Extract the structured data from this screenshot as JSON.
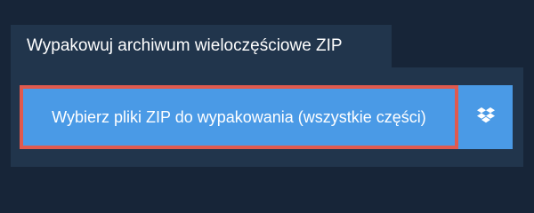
{
  "header": {
    "title": "Wypakowuj archiwum wieloczęściowe ZIP"
  },
  "upload": {
    "select_button_label": "Wybierz pliki ZIP do wypakowania (wszystkie części)",
    "dropbox_icon": "dropbox-icon"
  },
  "colors": {
    "page_background": "#172538",
    "panel_background": "#21354c",
    "button_background": "#4a9ae6",
    "button_focus_border": "#e05a4e",
    "text": "#ffffff"
  }
}
